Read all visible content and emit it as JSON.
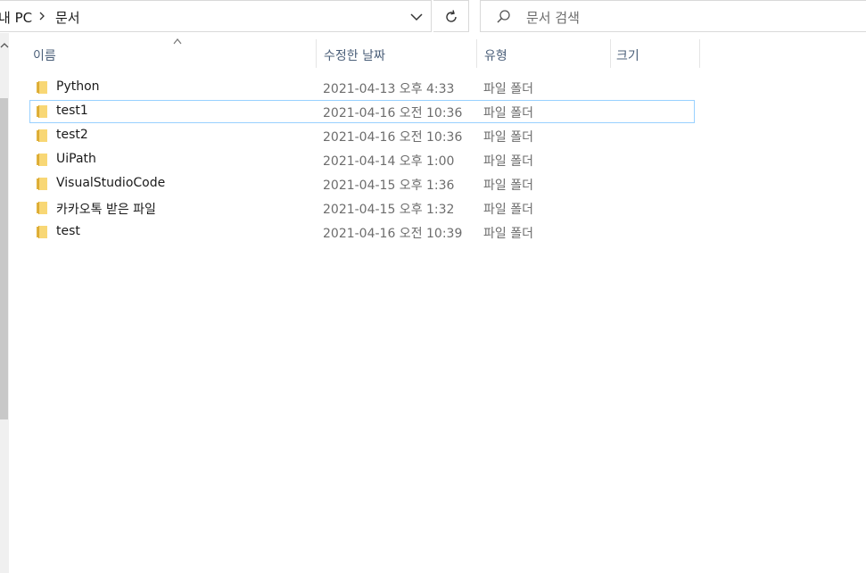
{
  "address_bar": {
    "breadcrumb": [
      "내 PC",
      "문서"
    ]
  },
  "search": {
    "placeholder": "문서 검색"
  },
  "columns": {
    "name": "이름",
    "date_modified": "수정한 날짜",
    "type": "유형",
    "size": "크기"
  },
  "files": [
    {
      "name": "Python",
      "date": "2021-04-13 오후 4:33",
      "type": "파일 폴더",
      "selected": false
    },
    {
      "name": "test1",
      "date": "2021-04-16 오전 10:36",
      "type": "파일 폴더",
      "selected": true
    },
    {
      "name": "test2",
      "date": "2021-04-16 오전 10:36",
      "type": "파일 폴더",
      "selected": false
    },
    {
      "name": "UiPath",
      "date": "2021-04-14 오후 1:00",
      "type": "파일 폴더",
      "selected": false
    },
    {
      "name": "VisualStudioCode",
      "date": "2021-04-15 오후 1:36",
      "type": "파일 폴더",
      "selected": false
    },
    {
      "name": "카카오톡 받은 파일",
      "date": "2021-04-15 오후 1:32",
      "type": "파일 폴더",
      "selected": false
    },
    {
      "name": "test",
      "date": "2021-04-16 오전 10:39",
      "type": "파일 폴더",
      "selected": false
    }
  ],
  "colors": {
    "selection_border": "#99d1ff",
    "folder_yellow": "#f8d775",
    "header_text": "#4c607a"
  }
}
